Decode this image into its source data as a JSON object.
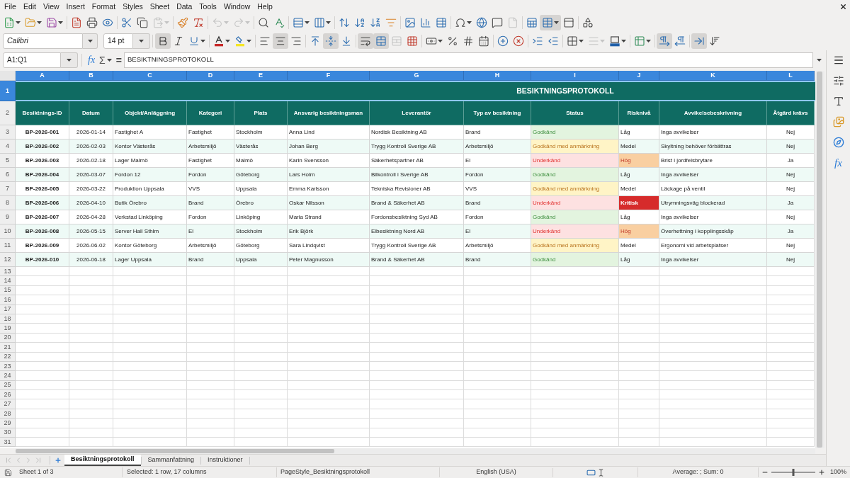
{
  "menu_bar": {
    "items": [
      "File",
      "Edit",
      "View",
      "Insert",
      "Format",
      "Styles",
      "Sheet",
      "Data",
      "Tools",
      "Window",
      "Help"
    ]
  },
  "standard_toolbar": {
    "groups": [
      [
        {
          "kind": "new",
          "pressed": false,
          "disabled": false
        },
        {
          "kind": "open",
          "pressed": false,
          "disabled": false
        },
        {
          "kind": "save",
          "pressed": false,
          "disabled": false
        }
      ],
      [
        {
          "kind": "export_pdf",
          "pressed": false,
          "disabled": false
        },
        {
          "kind": "print",
          "pressed": false,
          "disabled": false
        },
        {
          "kind": "print_preview",
          "pressed": false,
          "disabled": false
        }
      ],
      [
        {
          "kind": "cut",
          "pressed": false,
          "disabled": false
        },
        {
          "kind": "copy",
          "pressed": false,
          "disabled": false
        },
        {
          "kind": "paste",
          "pressed": false,
          "disabled": true
        }
      ],
      [
        {
          "kind": "clone_formatting",
          "pressed": false,
          "disabled": false
        },
        {
          "kind": "clear_formatting",
          "pressed": false,
          "disabled": false
        }
      ],
      [
        {
          "kind": "undo",
          "pressed": false,
          "disabled": true
        },
        {
          "kind": "redo",
          "pressed": false,
          "disabled": true
        }
      ],
      [
        {
          "kind": "find_replace",
          "pressed": false,
          "disabled": false
        },
        {
          "kind": "spelling",
          "pressed": false,
          "disabled": false
        }
      ],
      [
        {
          "kind": "row",
          "pressed": false,
          "disabled": false
        },
        {
          "kind": "column",
          "pressed": false,
          "disabled": false
        }
      ],
      [
        {
          "kind": "sort",
          "pressed": false,
          "disabled": false
        },
        {
          "kind": "sort_ascending",
          "pressed": false,
          "disabled": false
        },
        {
          "kind": "sort_descending",
          "pressed": false,
          "disabled": false
        },
        {
          "kind": "autofilter",
          "pressed": false,
          "disabled": false
        }
      ],
      [
        {
          "kind": "image",
          "pressed": false,
          "disabled": false
        },
        {
          "kind": "chart",
          "pressed": false,
          "disabled": false
        },
        {
          "kind": "pivot_table",
          "pressed": false,
          "disabled": false
        }
      ],
      [
        {
          "kind": "special_character",
          "pressed": false,
          "disabled": false
        },
        {
          "kind": "hyperlink",
          "pressed": false,
          "disabled": false
        },
        {
          "kind": "comment",
          "pressed": false,
          "disabled": false
        },
        {
          "kind": "header_footer",
          "pressed": false,
          "disabled": true
        }
      ],
      [
        {
          "kind": "print_area",
          "pressed": false,
          "disabled": false
        },
        {
          "kind": "freeze",
          "pressed": true,
          "disabled": false
        },
        {
          "kind": "split_window",
          "pressed": false,
          "disabled": false
        }
      ],
      [
        {
          "kind": "draw_functions",
          "pressed": false,
          "disabled": false
        }
      ]
    ]
  },
  "formatting_toolbar": {
    "font_name": "Calibri",
    "font_size": "14 pt",
    "groups": [
      [
        {
          "kind": "bold",
          "pressed": true,
          "disabled": false
        },
        {
          "kind": "italic",
          "pressed": false,
          "disabled": false
        },
        {
          "kind": "underline",
          "pressed": false,
          "disabled": false
        }
      ],
      [
        {
          "kind": "font_color",
          "pressed": false,
          "disabled": false
        },
        {
          "kind": "highlight",
          "pressed": false,
          "disabled": false
        }
      ],
      [
        {
          "kind": "align_left",
          "pressed": false,
          "disabled": false
        },
        {
          "kind": "align_center",
          "pressed": true,
          "disabled": false
        },
        {
          "kind": "align_right",
          "pressed": false,
          "disabled": false
        }
      ],
      [
        {
          "kind": "align_top",
          "pressed": false,
          "disabled": false
        },
        {
          "kind": "align_middle",
          "pressed": true,
          "disabled": false
        },
        {
          "kind": "align_bottom",
          "pressed": false,
          "disabled": false
        }
      ],
      [
        {
          "kind": "wrap_text",
          "pressed": true,
          "disabled": false
        },
        {
          "kind": "merge_center",
          "pressed": true,
          "disabled": false
        },
        {
          "kind": "unmerge",
          "pressed": false,
          "disabled": true
        },
        {
          "kind": "merge",
          "pressed": false,
          "disabled": false
        }
      ],
      [
        {
          "kind": "currency",
          "pressed": false,
          "disabled": false
        },
        {
          "kind": "percent",
          "pressed": false,
          "disabled": false
        },
        {
          "kind": "number",
          "pressed": false,
          "disabled": false
        },
        {
          "kind": "date",
          "pressed": false,
          "disabled": false
        }
      ],
      [
        {
          "kind": "add_decimal",
          "pressed": false,
          "disabled": false
        },
        {
          "kind": "delete_decimal",
          "pressed": false,
          "disabled": false
        }
      ],
      [
        {
          "kind": "indent_increase",
          "pressed": false,
          "disabled": false
        },
        {
          "kind": "indent_decrease",
          "pressed": false,
          "disabled": false
        }
      ],
      [
        {
          "kind": "borders",
          "pressed": false,
          "disabled": false
        },
        {
          "kind": "border_style",
          "pressed": false,
          "disabled": true
        },
        {
          "kind": "border_color",
          "pressed": false,
          "disabled": false
        }
      ],
      [
        {
          "kind": "conditional",
          "pressed": false,
          "disabled": false
        }
      ],
      [
        {
          "kind": "ltr",
          "pressed": true,
          "disabled": false
        },
        {
          "kind": "rtl",
          "pressed": false,
          "disabled": false
        }
      ],
      [
        {
          "kind": "text_horizontal",
          "pressed": true,
          "disabled": false
        },
        {
          "kind": "text_vertical",
          "pressed": false,
          "disabled": false
        }
      ]
    ]
  },
  "formula_bar": {
    "cell_reference": "A1:Q1",
    "function_wizard": "fx",
    "sum": "Σ",
    "equals": "=",
    "content": "BESIKTNINGSPROTOKOLL"
  },
  "sheet": {
    "columns": [
      {
        "label": "A",
        "selected": true
      },
      {
        "label": "B",
        "selected": true
      },
      {
        "label": "C",
        "selected": true
      },
      {
        "label": "D",
        "selected": true
      },
      {
        "label": "E",
        "selected": true
      },
      {
        "label": "F",
        "selected": true
      },
      {
        "label": "G",
        "selected": true
      },
      {
        "label": "H",
        "selected": true
      },
      {
        "label": "I",
        "selected": true
      },
      {
        "label": "J",
        "selected": true
      },
      {
        "label": "K",
        "selected": true
      },
      {
        "label": "L",
        "selected": true
      }
    ],
    "rows": [
      {
        "kind": "title",
        "number": "1",
        "selected": true,
        "title": "BESIKTNINGSPROTOKOLL"
      },
      {
        "kind": "header",
        "number": "2",
        "selected": false,
        "cells": [
          {
            "text": "Besiktnings-ID"
          },
          {
            "text": "Datum"
          },
          {
            "text": "Objekt/Anläggning"
          },
          {
            "text": "Kategori"
          },
          {
            "text": "Plats"
          },
          {
            "text": "Ansvarig besiktningsman"
          },
          {
            "text": "Leverantör"
          },
          {
            "text": "Typ av besiktning"
          },
          {
            "text": "Status"
          },
          {
            "text": "Risknivå"
          },
          {
            "text": "Avvikelsebeskrivning"
          },
          {
            "text": "Åtgärd krävs"
          }
        ]
      },
      {
        "kind": "data",
        "number": "3",
        "selected": false,
        "cells": [
          {
            "text": "BP-2026-001"
          },
          {
            "text": "2026-01-14"
          },
          {
            "text": "Fastighet A"
          },
          {
            "text": "Fastighet"
          },
          {
            "text": "Stockholm"
          },
          {
            "text": "Anna Lind"
          },
          {
            "text": "Nordisk Besiktning AB"
          },
          {
            "text": "Brand"
          },
          {
            "text": "Godkänd",
            "color": "#e3f4df"
          },
          {
            "text": "Låg"
          },
          {
            "text": "Inga avvikelser"
          },
          {
            "text": "Nej"
          }
        ]
      },
      {
        "kind": "data",
        "number": "4",
        "selected": false,
        "cells": [
          {
            "text": "BP-2026-002"
          },
          {
            "text": "2026-02-03"
          },
          {
            "text": "Kontor Västerås"
          },
          {
            "text": "Arbetsmiljö"
          },
          {
            "text": "Västerås"
          },
          {
            "text": "Johan Berg"
          },
          {
            "text": "Trygg Kontroll Sverige AB"
          },
          {
            "text": "Arbetsmiljö"
          },
          {
            "text": "Godkänd med anmärkning",
            "color": "#fff4c6"
          },
          {
            "text": "Medel"
          },
          {
            "text": "Skyltning behöver förbättras"
          },
          {
            "text": "Nej"
          }
        ]
      },
      {
        "kind": "data",
        "number": "5",
        "selected": false,
        "cells": [
          {
            "text": "BP-2026-003"
          },
          {
            "text": "2026-02-18"
          },
          {
            "text": "Lager Malmö"
          },
          {
            "text": "Fastighet"
          },
          {
            "text": "Malmö"
          },
          {
            "text": "Karin Svensson"
          },
          {
            "text": "Säkerhetspartner AB"
          },
          {
            "text": "El"
          },
          {
            "text": "Underkänd",
            "color": "#fde1e1"
          },
          {
            "text": "Hög",
            "color": "#f9cfa1"
          },
          {
            "text": "Brist i jordfelsbrytare"
          },
          {
            "text": "Ja"
          }
        ]
      },
      {
        "kind": "data",
        "number": "6",
        "selected": false,
        "cells": [
          {
            "text": "BP-2026-004"
          },
          {
            "text": "2026-03-07"
          },
          {
            "text": "Fordon 12"
          },
          {
            "text": "Fordon"
          },
          {
            "text": "Göteborg"
          },
          {
            "text": "Lars Holm"
          },
          {
            "text": "Bilkontroll i Sverige AB"
          },
          {
            "text": "Fordon"
          },
          {
            "text": "Godkänd",
            "color": "#e3f4df"
          },
          {
            "text": "Låg"
          },
          {
            "text": "Inga avvikelser"
          },
          {
            "text": "Nej"
          }
        ]
      },
      {
        "kind": "data",
        "number": "7",
        "selected": false,
        "cells": [
          {
            "text": "BP-2026-005"
          },
          {
            "text": "2026-03-22"
          },
          {
            "text": "Produktion Uppsala"
          },
          {
            "text": "VVS"
          },
          {
            "text": "Uppsala"
          },
          {
            "text": "Emma Karlsson"
          },
          {
            "text": "Tekniska Revisioner AB"
          },
          {
            "text": "VVS"
          },
          {
            "text": "Godkänd med anmärkning",
            "color": "#fff4c6"
          },
          {
            "text": "Medel"
          },
          {
            "text": "Läckage på ventil"
          },
          {
            "text": "Nej"
          }
        ]
      },
      {
        "kind": "data",
        "number": "8",
        "selected": false,
        "cells": [
          {
            "text": "BP-2026-006"
          },
          {
            "text": "2026-04-10"
          },
          {
            "text": "Butik Örebro"
          },
          {
            "text": "Brand"
          },
          {
            "text": "Örebro"
          },
          {
            "text": "Oskar Nilsson"
          },
          {
            "text": "Brand & Säkerhet AB"
          },
          {
            "text": "Brand"
          },
          {
            "text": "Underkänd",
            "color": "#fde1e1"
          },
          {
            "text": "Kritisk",
            "color": "#d62b2b"
          },
          {
            "text": "Utrymningsväg blockerad"
          },
          {
            "text": "Ja"
          }
        ]
      },
      {
        "kind": "data",
        "number": "9",
        "selected": false,
        "cells": [
          {
            "text": "BP-2026-007"
          },
          {
            "text": "2026-04-28"
          },
          {
            "text": "Verkstad Linköping"
          },
          {
            "text": "Fordon"
          },
          {
            "text": "Linköping"
          },
          {
            "text": "Maria Strand"
          },
          {
            "text": "Fordonsbesiktning Syd AB"
          },
          {
            "text": "Fordon"
          },
          {
            "text": "Godkänd",
            "color": "#e3f4df"
          },
          {
            "text": "Låg"
          },
          {
            "text": "Inga avvikelser"
          },
          {
            "text": "Nej"
          }
        ]
      },
      {
        "kind": "data",
        "number": "10",
        "selected": false,
        "cells": [
          {
            "text": "BP-2026-008"
          },
          {
            "text": "2026-05-15"
          },
          {
            "text": "Server Hall Sthlm"
          },
          {
            "text": "El"
          },
          {
            "text": "Stockholm"
          },
          {
            "text": "Erik Björk"
          },
          {
            "text": "Elbesiktning Nord AB"
          },
          {
            "text": "El"
          },
          {
            "text": "Underkänd",
            "color": "#fde1e1"
          },
          {
            "text": "Hög",
            "color": "#f9cfa1"
          },
          {
            "text": "Överhettning i kopplingsskåp"
          },
          {
            "text": "Ja"
          }
        ]
      },
      {
        "kind": "data",
        "number": "11",
        "selected": false,
        "cells": [
          {
            "text": "BP-2026-009"
          },
          {
            "text": "2026-06-02"
          },
          {
            "text": "Kontor Göteborg"
          },
          {
            "text": "Arbetsmiljö"
          },
          {
            "text": "Göteborg"
          },
          {
            "text": "Sara Lindqvist"
          },
          {
            "text": "Trygg Kontroll Sverige AB"
          },
          {
            "text": "Arbetsmiljö"
          },
          {
            "text": "Godkänd med anmärkning",
            "color": "#fff4c6"
          },
          {
            "text": "Medel"
          },
          {
            "text": "Ergonomi vid arbetsplatser"
          },
          {
            "text": "Nej"
          }
        ]
      },
      {
        "kind": "data",
        "number": "12",
        "selected": false,
        "cells": [
          {
            "text": "BP-2026-010"
          },
          {
            "text": "2026-06-18"
          },
          {
            "text": "Lager Uppsala"
          },
          {
            "text": "Brand"
          },
          {
            "text": "Uppsala"
          },
          {
            "text": "Peter Magnusson"
          },
          {
            "text": "Brand & Säkerhet AB"
          },
          {
            "text": "Brand"
          },
          {
            "text": "Godkänd",
            "color": "#e3f4df"
          },
          {
            "text": "Låg"
          },
          {
            "text": "Inga avvikelser"
          },
          {
            "text": "Nej"
          }
        ]
      },
      {
        "kind": "empty",
        "number": "13",
        "selected": false
      },
      {
        "kind": "empty",
        "number": "14",
        "selected": false
      },
      {
        "kind": "empty",
        "number": "15",
        "selected": false
      },
      {
        "kind": "empty",
        "number": "16",
        "selected": false
      },
      {
        "kind": "empty",
        "number": "17",
        "selected": false
      },
      {
        "kind": "empty",
        "number": "18",
        "selected": false
      },
      {
        "kind": "empty",
        "number": "19",
        "selected": false
      },
      {
        "kind": "empty",
        "number": "20",
        "selected": false
      },
      {
        "kind": "empty",
        "number": "21",
        "selected": false
      },
      {
        "kind": "empty",
        "number": "22",
        "selected": false
      },
      {
        "kind": "empty",
        "number": "23",
        "selected": false
      },
      {
        "kind": "empty",
        "number": "24",
        "selected": false
      },
      {
        "kind": "empty",
        "number": "25",
        "selected": false
      },
      {
        "kind": "empty",
        "number": "26",
        "selected": false
      },
      {
        "kind": "empty",
        "number": "27",
        "selected": false
      },
      {
        "kind": "empty",
        "number": "28",
        "selected": false
      },
      {
        "kind": "empty",
        "number": "29",
        "selected": false
      },
      {
        "kind": "empty",
        "number": "30",
        "selected": false
      },
      {
        "kind": "empty",
        "number": "31",
        "selected": false
      }
    ]
  },
  "sheet_tabs": [
    {
      "label": "Besiktningsprotokoll",
      "selected": true
    },
    {
      "label": "Sammanfattning",
      "selected": false
    },
    {
      "label": "Instruktioner",
      "selected": false
    }
  ],
  "sidebar": {
    "functions": "fx"
  },
  "status_bar": {
    "sheet": "Sheet 1 of 3",
    "selection": "Selected: 1 row, 17 columns",
    "page_style": "PageStyle_Besiktningsprotokoll",
    "language": "English (USA)",
    "summary": "Average: ; Sum: 0",
    "zoom": {
      "level": 0.5,
      "reading": "100%"
    }
  }
}
